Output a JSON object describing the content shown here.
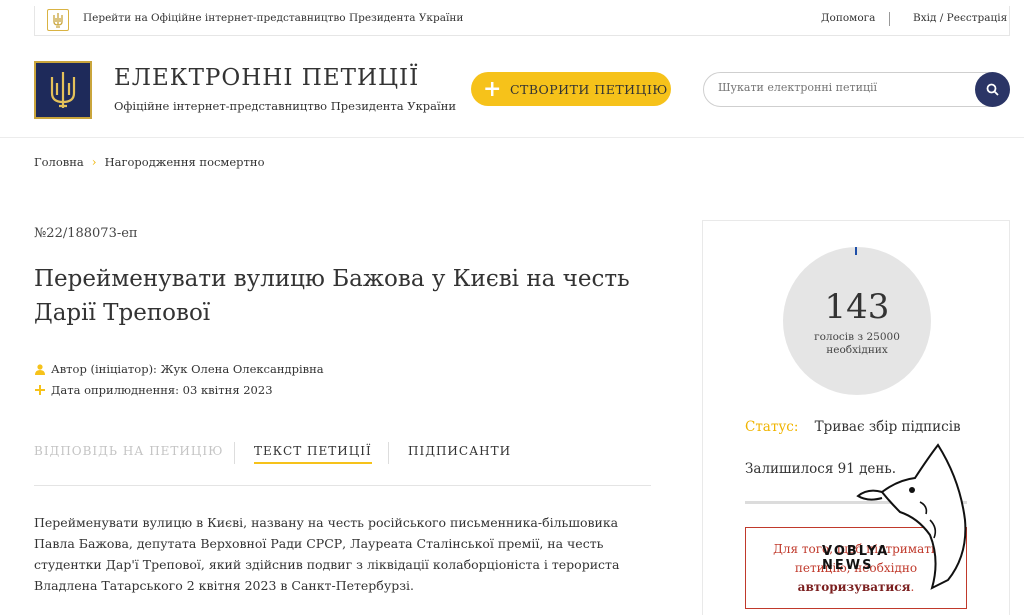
{
  "topbar": {
    "president_link": "Перейти на Офіційне інтернет-представництво Президента України",
    "help": "Допомога",
    "login": "Вхід / Реєстрація"
  },
  "header": {
    "title": "ЕЛЕКТРОННІ ПЕТИЦІЇ",
    "subtitle": "Офіційне інтернет-представництво Президента України",
    "create_button": "СТВОРИТИ ПЕТИЦІЮ",
    "search_placeholder": "Шукати електронні петиції"
  },
  "breadcrumb": {
    "home": "Головна",
    "current": "Нагородження посмертно"
  },
  "petition": {
    "number": "№22/188073-еп",
    "title": "Перейменувати вулицю Бажова у Києві на честь Дарії Трепової",
    "author": "Автор (ініціатор): Жук Олена Олександрівна",
    "published": "Дата оприлюднення: 03 квітня 2023",
    "body": "Перейменувати вулицю в Києві, названу на честь російського письменника-більшовика Павла Бажова, депутата Верховної Ради СРСР, Лауреата Сталінської премії, на честь студентки Дар'ї Трепової, який здійснив подвиг з ліквідації колаборціоніста і терориста Владлена Татарського 2 квітня 2023 в Санкт-Петербурзі."
  },
  "tabs": {
    "answer": "ВІДПОВІДЬ НА ПЕТИЦІЮ",
    "text": "ТЕКСТ ПЕТИЦІЇ",
    "signers": "ПІДПИСАНТИ"
  },
  "sidebar": {
    "votes": "143",
    "votes_sub": "голосів з 25000 необхідних",
    "votes_fraction": 0.00572,
    "status_label": "Статус:",
    "status_value": "Триває збір підписів",
    "remaining": "Залишилося 91 день.",
    "notice_text": "Для того, щоб підтримати петицію, необхідно",
    "notice_link": "авторизуватися",
    "notice_end": "."
  },
  "watermark": {
    "text": "VOBLYA NEWS"
  },
  "colors": {
    "accent_yellow": "#f6c21a",
    "navy": "#2b3566",
    "alert_red": "#c0392b"
  },
  "icons": {
    "emblem": "trident-icon",
    "search": "search-icon",
    "author": "user-icon",
    "date": "plus-icon"
  }
}
